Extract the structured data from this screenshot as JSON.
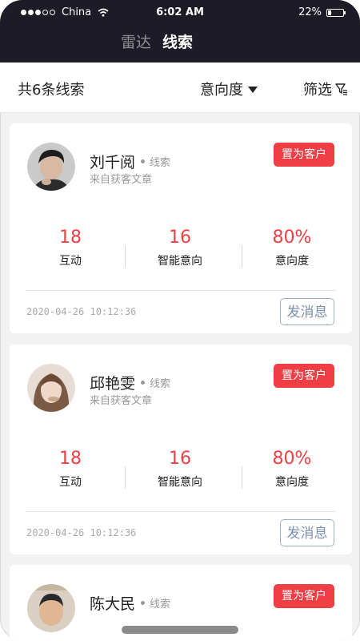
{
  "status_bar": {
    "carrier": "China",
    "time": "6:02 AM",
    "battery": "22%",
    "battery_level": 0.22
  },
  "nav": {
    "tabs": [
      {
        "label": "雷达",
        "active": false
      },
      {
        "label": "线索",
        "active": true
      }
    ]
  },
  "filter_bar": {
    "total": "共6条线索",
    "sort_label": "意向度",
    "filter_label": "筛选"
  },
  "cards": [
    {
      "name": "刘千阅",
      "tag": "线索",
      "source": "来自获客文章",
      "action_label": "置为客户",
      "stats": [
        {
          "value": "18",
          "label": "互动"
        },
        {
          "value": "16",
          "label": "智能意向"
        },
        {
          "value": "80%",
          "label": "意向度"
        }
      ],
      "timestamp": "2020-04-26  10:12:36",
      "send_label": "发消息"
    },
    {
      "name": "邱艳雯",
      "tag": "线索",
      "source": "来自获客文章",
      "action_label": "置为客户",
      "stats": [
        {
          "value": "18",
          "label": "互动"
        },
        {
          "value": "16",
          "label": "智能意向"
        },
        {
          "value": "80%",
          "label": "意向度"
        }
      ],
      "timestamp": "2020-04-26  10:12:36",
      "send_label": "发消息"
    },
    {
      "name": "陈大民",
      "tag": "线索",
      "action_label": "置为客户"
    }
  ],
  "colors": {
    "header_bg": "#1d1c26",
    "accent_red": "#f03e45",
    "send_border": "#9fb0c6"
  },
  "icons": [
    "signal-dots-icon",
    "wifi-icon",
    "battery-icon",
    "caret-down-icon",
    "filter-funnel-icon"
  ]
}
